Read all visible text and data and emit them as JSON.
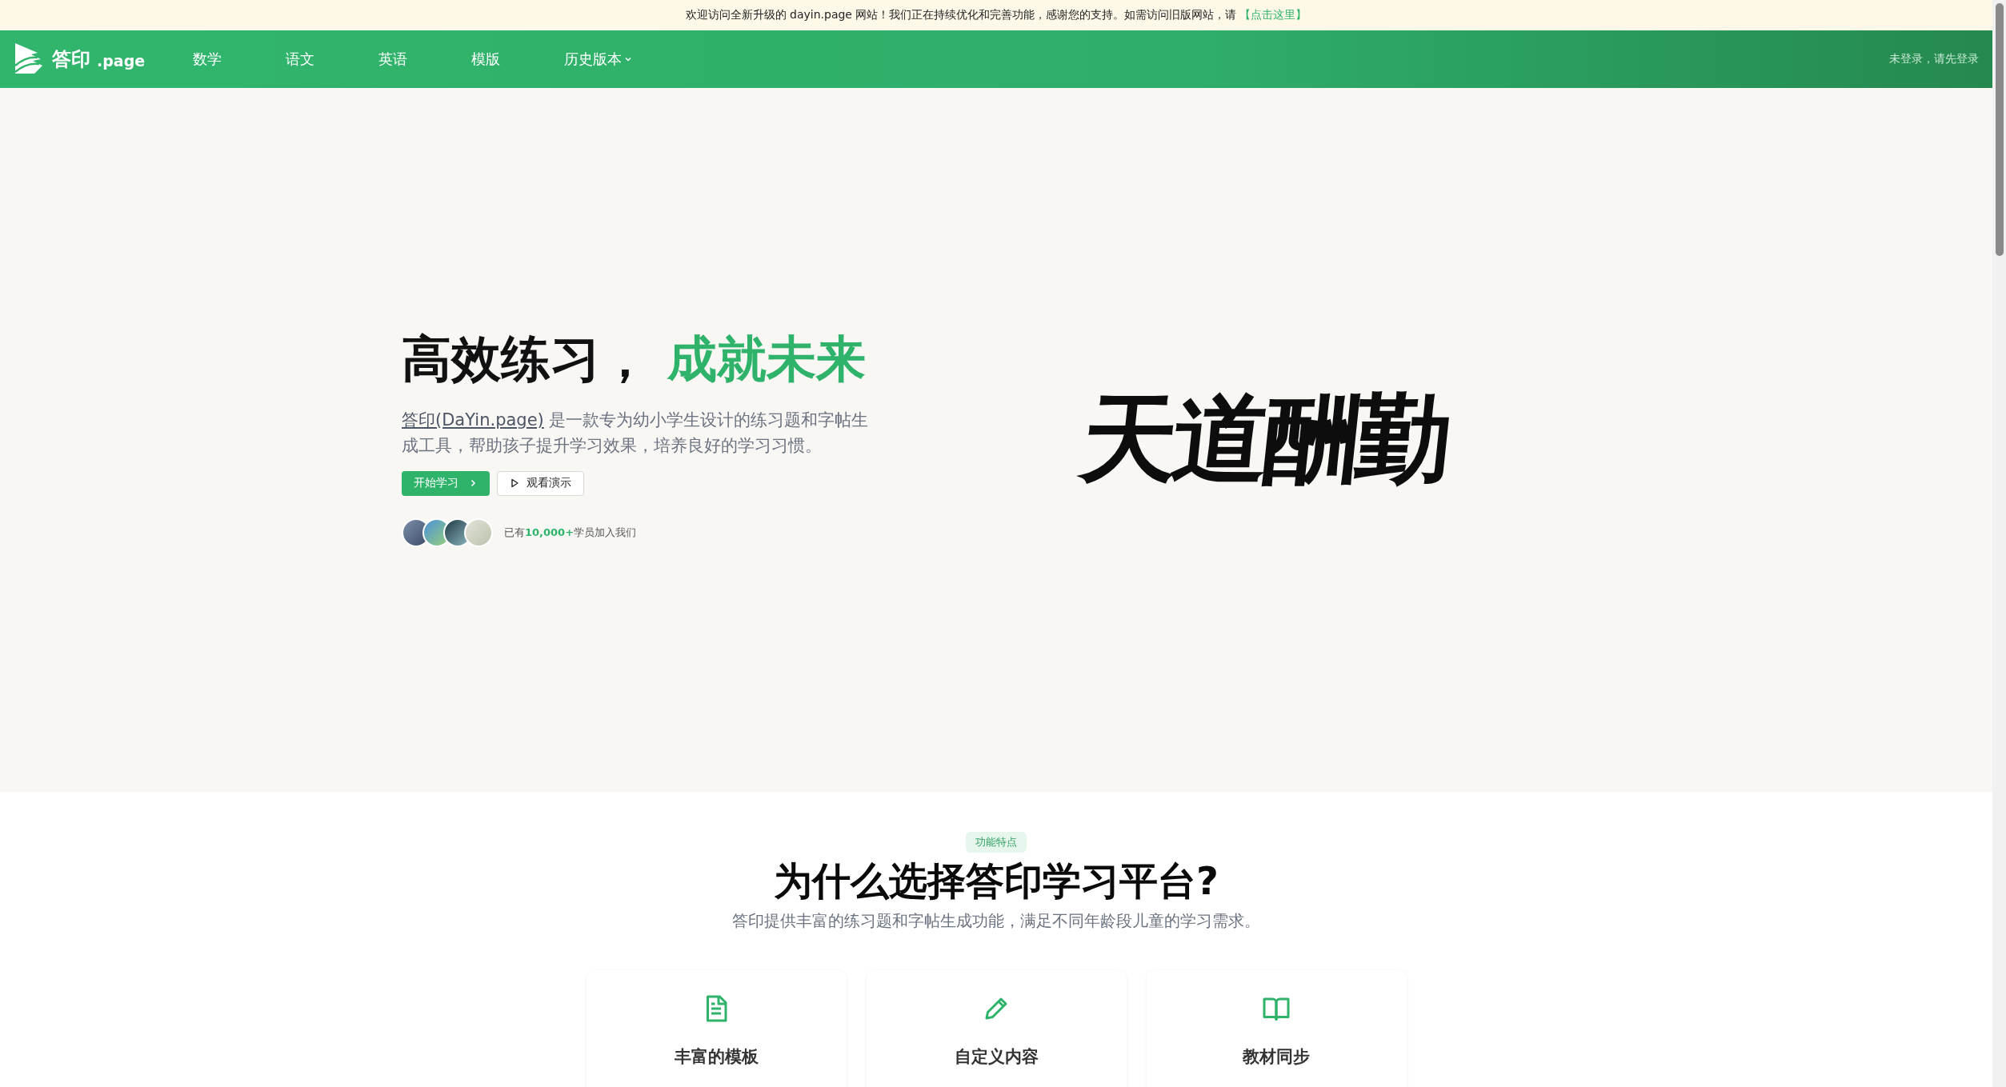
{
  "banner": {
    "text": "欢迎访问全新升级的 dayin.page 网站！我们正在持续优化和完善功能，感谢您的支持。如需访问旧版网站，请",
    "link": "【点击这里】"
  },
  "nav": {
    "logo": {
      "name": "答印",
      "suffix": ".page"
    },
    "items": [
      {
        "label": "数学",
        "dropdown": false
      },
      {
        "label": "语文",
        "dropdown": false
      },
      {
        "label": "英语",
        "dropdown": false
      },
      {
        "label": "模版",
        "dropdown": false
      },
      {
        "label": "历史版本",
        "dropdown": true
      }
    ],
    "login": "未登录，请先登录"
  },
  "hero": {
    "title": "高效练习，",
    "title_highlight": "成就未来",
    "description_link": "答印(DaYin.page)",
    "description": "是一款专为幼小学生设计的练习题和字帖生成工具，帮助孩子提升学习效果，培养良好的学习习惯。",
    "buttons": [
      {
        "label": "开始学习",
        "kind": "primary"
      },
      {
        "label": "观看演示",
        "kind": "secondary"
      }
    ],
    "stat": "已有**10,000+**学员加入我们",
    "calligraphy": "天道酬勤"
  },
  "features": {
    "badge": "功能特点",
    "title": "为什么选择答印学习平台?",
    "subtitle": "答印提供丰富的练习题和字帖生成功能，满足不同年龄段儿童的学习需求。",
    "cards": [
      {
        "title": "丰富的模板",
        "kind": "document"
      },
      {
        "title": "自定义内容",
        "kind": "pencil"
      },
      {
        "title": "教材同步",
        "kind": "book"
      }
    ]
  }
}
